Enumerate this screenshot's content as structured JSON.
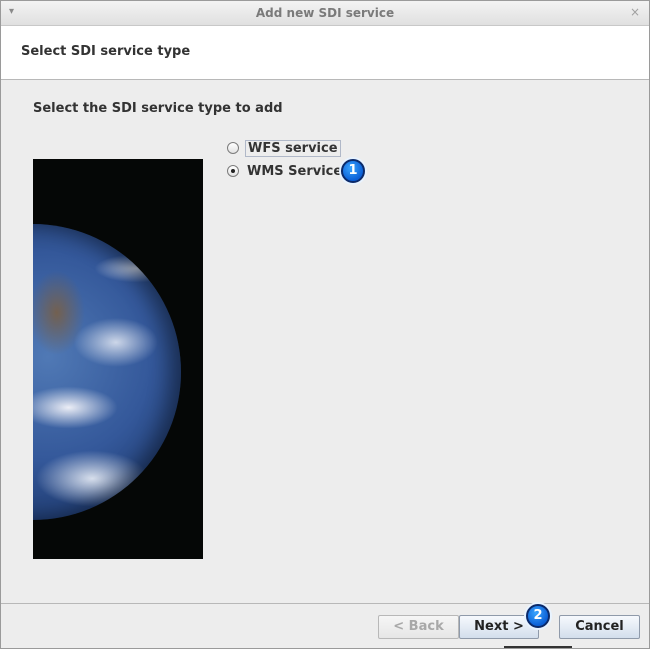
{
  "window": {
    "title": "Add new SDI service",
    "close_glyph": "×",
    "menu_glyph": "▾"
  },
  "header": {
    "heading": "Select SDI service type"
  },
  "content": {
    "prompt": "Select the SDI service type to add",
    "image": {
      "subject": "earth-globe"
    },
    "options": [
      {
        "label": "WFS service",
        "checked": false
      },
      {
        "label": "WMS Service",
        "checked": true
      }
    ]
  },
  "markers": [
    {
      "label": "1"
    },
    {
      "label": "2"
    }
  ],
  "footer": {
    "back_label": "< Back",
    "next_label": "Next >",
    "cancel_label": "Cancel"
  },
  "colors": {
    "marker": "#0b5fd6",
    "window_bg": "#ededed"
  }
}
